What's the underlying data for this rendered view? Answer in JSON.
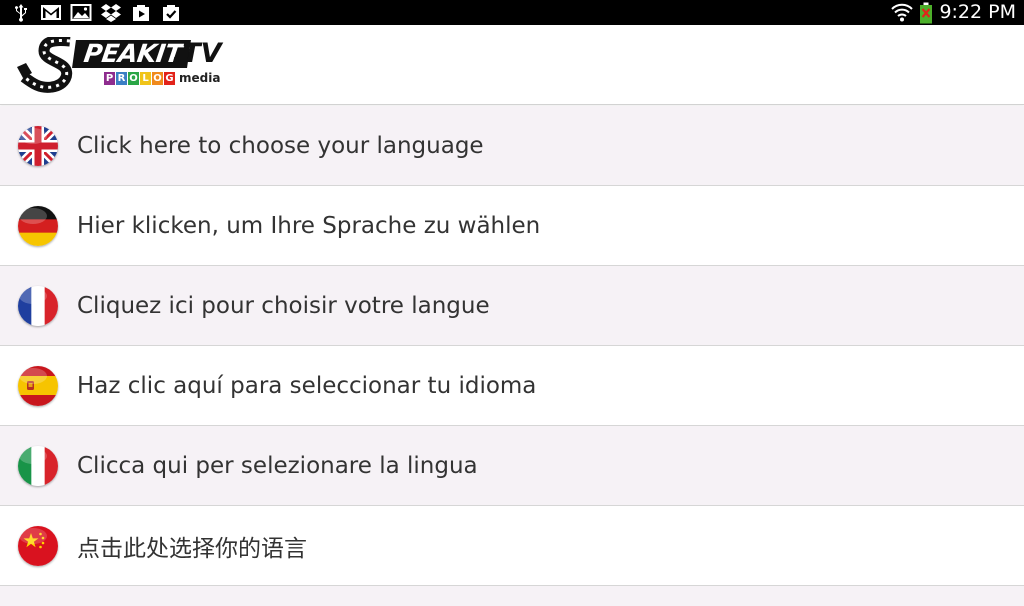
{
  "status_bar": {
    "left_icons": [
      "usb-icon",
      "gmail-icon",
      "gallery-icon",
      "dropbox-icon",
      "play-store-icon",
      "download-check-icon"
    ],
    "right_icons": [
      "wifi-icon",
      "battery-icon"
    ],
    "time": "9:22 PM"
  },
  "header": {
    "logo": {
      "word": "PEAKIT",
      "suffix": ".TV",
      "sub_letters": [
        "P",
        "R",
        "O",
        "L",
        "O",
        "G"
      ],
      "sub_colors": [
        "#8e2c8e",
        "#3b7fc4",
        "#2aa646",
        "#f0c419",
        "#f08a1c",
        "#e2231a"
      ],
      "sub_media": "media"
    }
  },
  "languages": [
    {
      "flag": "uk-flag-icon",
      "label": "Click here to choose your language"
    },
    {
      "flag": "germany-flag-icon",
      "label": "Hier klicken, um Ihre Sprache zu wählen"
    },
    {
      "flag": "france-flag-icon",
      "label": "Cliquez ici pour choisir votre langue"
    },
    {
      "flag": "spain-flag-icon",
      "label": "Haz clic aquí para seleccionar tu idioma"
    },
    {
      "flag": "italy-flag-icon",
      "label": "Clicca qui per selezionare la lingua"
    },
    {
      "flag": "china-flag-icon",
      "label": "点击此处选择你的语言"
    }
  ],
  "colors": {
    "row_alt": "#f6f2f6",
    "row": "#ffffff",
    "text": "#333333",
    "status_bar": "#000000"
  }
}
